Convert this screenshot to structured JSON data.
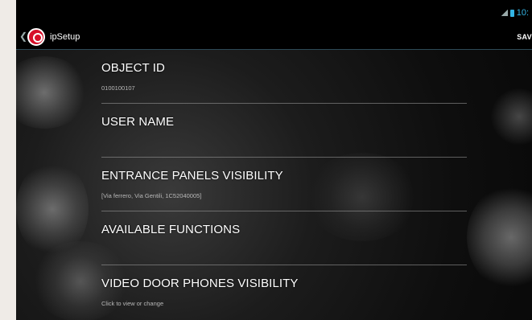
{
  "status": {
    "time": "10:"
  },
  "actionbar": {
    "title": "ipSetup",
    "back_glyph": "❮",
    "save_label": "SAV"
  },
  "settings": [
    {
      "title": "OBJECT ID",
      "subtitle": "0100100107"
    },
    {
      "title": "USER NAME",
      "subtitle": ""
    },
    {
      "title": "ENTRANCE PANELS VISIBILITY",
      "subtitle": "[Via ferrero, Via Gentili, 1C52040005]"
    },
    {
      "title": "AVAILABLE FUNCTIONS",
      "subtitle": ""
    },
    {
      "title": "VIDEO DOOR PHONES VISIBILITY",
      "subtitle": "Click to view or change"
    }
  ],
  "colors": {
    "accent": "#33b5e5",
    "brand": "#d6102a",
    "background": "#0e0e0e"
  },
  "icons": {
    "back": "chevron-left-icon",
    "logo": "ipsetup-logo-icon",
    "signal": "signal-icon",
    "battery": "battery-icon"
  }
}
